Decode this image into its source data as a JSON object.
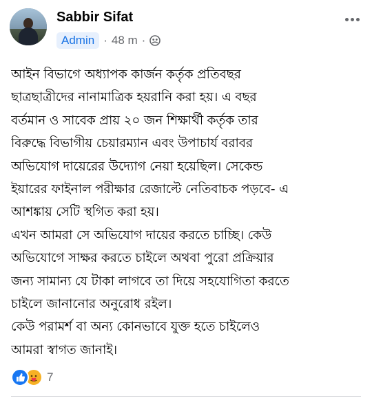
{
  "post": {
    "author": "Sabbir Sifat",
    "badge": "Admin",
    "time": "48 m",
    "separator": "·",
    "audience_icon": "group-icon",
    "more_icon": "more-horizontal-icon",
    "lines": [
      "আইন বিভাগে অধ্যাপক কার্জন কর্তৃক প্রতিবছর",
      "ছাত্রছাত্রীদের নানামাত্রিক হয়রানি করা হয়। এ বছর",
      "বর্তমান ও সাবেক প্রায় ২০ জন শিক্ষার্থী কর্তৃক তার",
      "বিরুদ্ধে বিভাগীয় চেয়ারম্যান এবং উপাচার্য বরাবর",
      "অভিযোগ দায়েরের উদ্যোগ নেয়া হয়েছিল। সেকেন্ড",
      "ইয়ারের ফাইনাল পরীক্ষার রেজাল্টে নেতিবাচক পড়বে- এ",
      "আশঙ্কায় সেটি স্থগিত করা হয়।",
      "এখন আমরা সে অভিযোগ দায়ের করতে চাচ্ছি। কেউ",
      "অভিযোগে সাক্ষর করতে চাইলে অথবা পুরো প্রক্রিয়ার",
      "জন্য সামান্য যে টাকা লাগবে তা দিয়ে সহযোগিতা করতে",
      "চাইলে জানানোর অনুরোধ রইল।",
      "কেউ পরামর্শ বা অন্য কোনভাবে যুক্ত হতে চাইলেও",
      "আমরা স্বাগত জানাই।"
    ],
    "reactions": {
      "icons": [
        "like-icon",
        "care-icon"
      ],
      "count": "7"
    }
  },
  "colors": {
    "badge_bg": "#e7f0fd",
    "badge_text": "#1b74e4",
    "secondary_text": "#65676b",
    "like_blue": "#1877f2",
    "care_yellow": "#f7b125"
  }
}
